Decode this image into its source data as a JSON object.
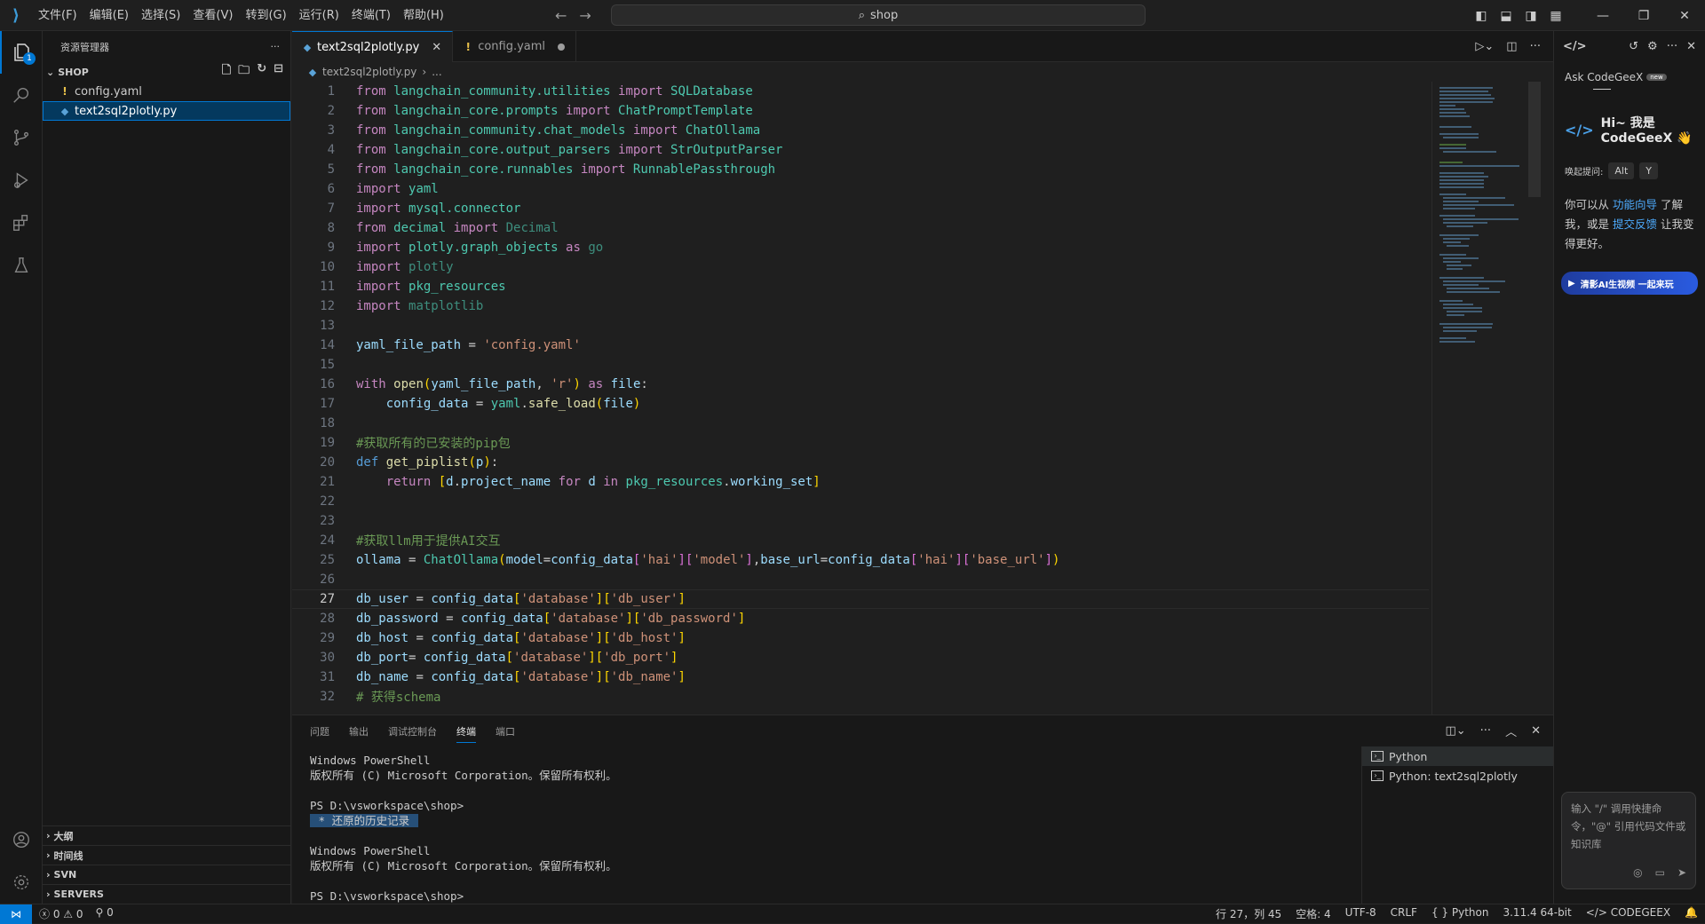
{
  "menu": [
    "文件(F)",
    "编辑(E)",
    "选择(S)",
    "查看(V)",
    "转到(G)",
    "运行(R)",
    "终端(T)",
    "帮助(H)"
  ],
  "search": {
    "text": "shop"
  },
  "sidebar": {
    "title": "资源管理器",
    "folder": "SHOP",
    "files": [
      {
        "name": "config.yaml",
        "type": "yaml"
      },
      {
        "name": "text2sql2plotly.py",
        "type": "py"
      }
    ],
    "bottom_sections": [
      "大纲",
      "时间线",
      "SVN",
      "SERVERS"
    ]
  },
  "activity_badge": "1",
  "tabs": [
    {
      "label": "text2sql2plotly.py",
      "active": true
    },
    {
      "label": "config.yaml",
      "active": false
    }
  ],
  "breadcrumb": [
    "text2sql2plotly.py",
    "..."
  ],
  "panel": {
    "tabs": [
      "问题",
      "输出",
      "调试控制台",
      "终端",
      "端口"
    ],
    "active_tab": "终端",
    "terminal_lines": [
      "Windows PowerShell",
      "版权所有 (C) Microsoft Corporation。保留所有权利。",
      "",
      "PS D:\\vsworkspace\\shop>",
      "",
      "",
      "Windows PowerShell",
      "版权所有 (C) Microsoft Corporation。保留所有权利。",
      "",
      "PS D:\\vsworkspace\\shop>"
    ],
    "history_restored": " * 还原的历史记录 ",
    "terminals": [
      "Python",
      "Python: text2sql2plotly"
    ]
  },
  "codegeex": {
    "title": "Ask CodeGeeX",
    "hello_line1": "Hi~ 我是",
    "hello_line2": "CodeGeeX 👋",
    "shortcut_label": "唤起提问:",
    "key1": "Alt",
    "key2": "Y",
    "desc_part1": "你可以从 ",
    "desc_link1": "功能向导",
    "desc_part2": " 了解我，或是 ",
    "desc_link2": "提交反馈",
    "desc_part3": " 让我变得更好。",
    "banner": "清影AI生视频 一起来玩",
    "input_placeholder": "输入 \"/\" 调用快捷命令，\"@\" 引用代码文件或知识库"
  },
  "status": {
    "errors": "0",
    "warnings": "0",
    "ports": "0",
    "position": "行 27，列 45",
    "spaces": "空格: 4",
    "encoding": "UTF-8",
    "eol": "CRLF",
    "language": "Python",
    "interpreter": "3.11.4 64-bit",
    "codegeex": "CODEGEEX"
  },
  "code_current_line": 27
}
